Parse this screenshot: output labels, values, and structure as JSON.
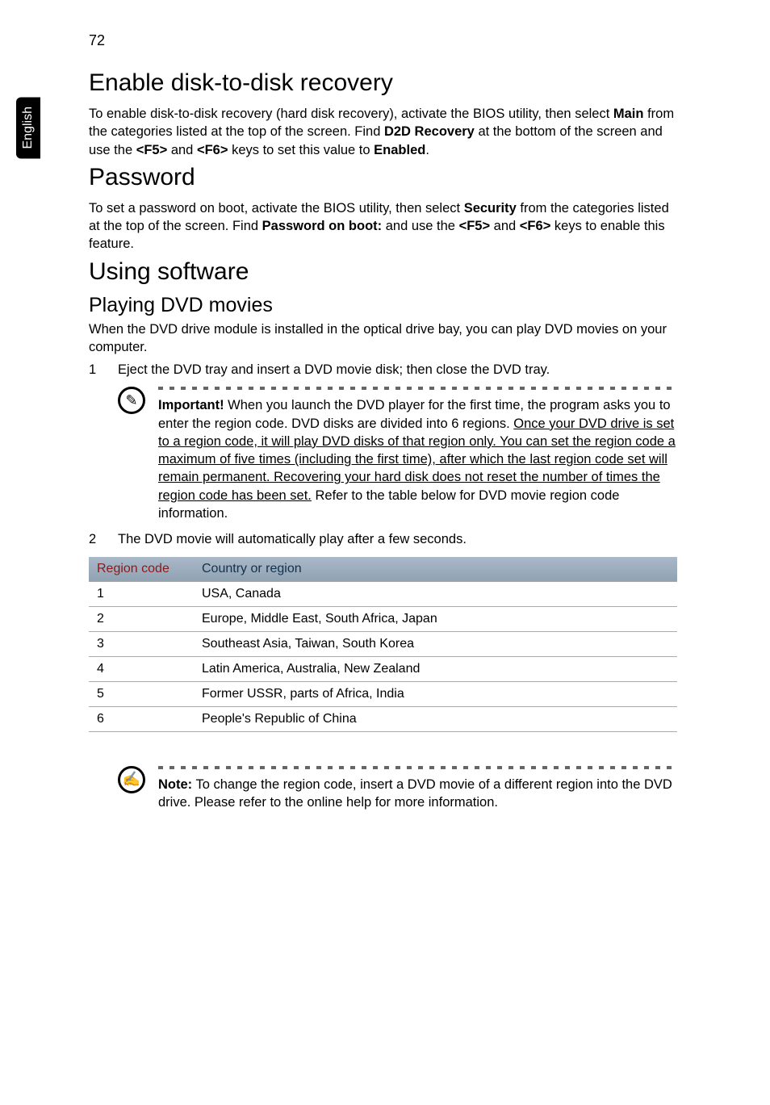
{
  "page_number": "72",
  "side_tab": "English",
  "h1_recovery": "Enable disk-to-disk recovery",
  "recovery_body": {
    "pre1": "To enable disk-to-disk recovery (hard disk recovery), activate the BIOS utility, then select ",
    "b1": "Main",
    "mid1": " from the categories listed at the top of the screen. Find ",
    "b2": "D2D Recovery",
    "mid2": " at the bottom of the screen and use the ",
    "b3": "<F5>",
    "mid3": " and ",
    "b4": "<F6>",
    "mid4": " keys to set this value to ",
    "b5": "Enabled",
    "end": "."
  },
  "h1_password": "Password",
  "password_body": {
    "pre1": "To set a password on boot, activate the BIOS utility, then select ",
    "b1": "Security",
    "mid1": " from the categories listed at the top of the screen. Find ",
    "b2": "Password on boot:",
    "mid2": " and use the ",
    "b3": "<F5>",
    "mid3": " and ",
    "b4": "<F6>",
    "end": " keys to enable this feature."
  },
  "h1_software": "Using software",
  "h2_dvd": "Playing DVD movies",
  "dvd_intro": "When the DVD drive module is installed in the optical drive bay, you can play DVD movies on your computer.",
  "list": {
    "n1": "1",
    "t1": "Eject the DVD tray and insert a DVD movie disk; then close the DVD tray.",
    "n2": "2",
    "t2": "The DVD movie will automatically play after a few seconds."
  },
  "important": {
    "b_label": "Important!",
    "pre": " When you launch the DVD player for the first time, the program asks you to enter the region code. DVD disks are divided into 6 regions. ",
    "u_text": "Once your DVD drive is set to a region code, it will play DVD disks of that region only. You can set the region code a maximum of five times (including the first time), after which the last region code set will remain permanent. Recovering your hard disk does not reset the number of times the region code has been set.",
    "post": " Refer to the table below for DVD movie region code information."
  },
  "table": {
    "h1": "Region code",
    "h2": "Country or region",
    "rows": [
      {
        "code": "1",
        "region": "USA, Canada"
      },
      {
        "code": "2",
        "region": "Europe, Middle East, South Africa, Japan"
      },
      {
        "code": "3",
        "region": "Southeast Asia, Taiwan, South Korea"
      },
      {
        "code": "4",
        "region": "Latin America, Australia, New Zealand"
      },
      {
        "code": "5",
        "region": "Former USSR, parts of Africa, India"
      },
      {
        "code": "6",
        "region": "People's Republic of China"
      }
    ]
  },
  "note": {
    "b_label": "Note:",
    "text": " To change the region code, insert a DVD movie of a different region into the DVD drive. Please refer to the online help for more information."
  },
  "icons": {
    "pin": "✎",
    "hand": "✍"
  }
}
